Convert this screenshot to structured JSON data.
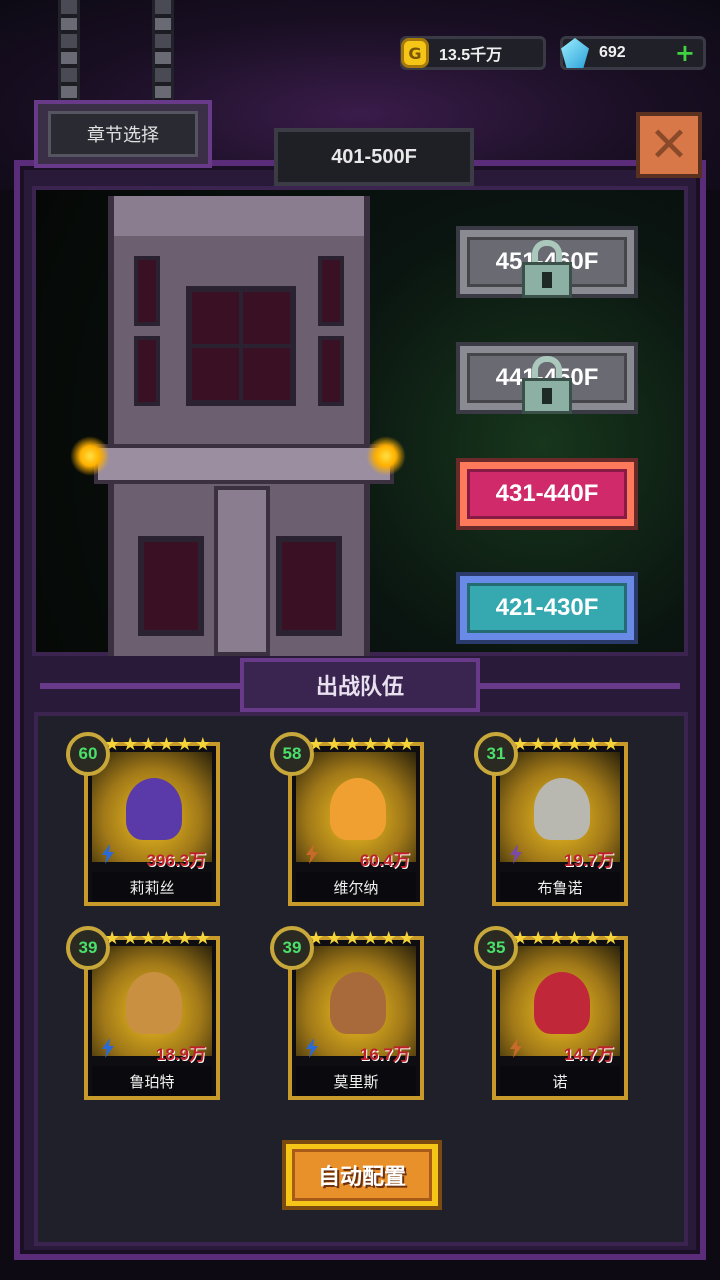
{
  "currency": {
    "coins": "13.5千万",
    "gems": "692",
    "coin_icon_label": "G"
  },
  "header": {
    "chapter_button": "章节选择",
    "floor_range_title": "401-500F",
    "close_label": "✕"
  },
  "floors": [
    {
      "label": "451-460F",
      "state": "locked"
    },
    {
      "label": "441-450F",
      "state": "locked"
    },
    {
      "label": "431-440F",
      "state": "current"
    },
    {
      "label": "421-430F",
      "state": "cleared"
    }
  ],
  "team": {
    "title": "出战队伍",
    "heroes": [
      {
        "name": "莉莉丝",
        "level": "60",
        "power": "396.3万",
        "color": "#5a3aa8",
        "element": "lightning"
      },
      {
        "name": "维尔纳",
        "level": "58",
        "power": "60.4万",
        "color": "#f0a030",
        "element": "flame"
      },
      {
        "name": "布鲁诺",
        "level": "31",
        "power": "19.7万",
        "color": "#b8b8b0",
        "element": "dark"
      },
      {
        "name": "鲁珀特",
        "level": "39",
        "power": "18.9万",
        "color": "#c89040",
        "element": "lightning"
      },
      {
        "name": "莫里斯",
        "level": "39",
        "power": "16.7万",
        "color": "#a86a3a",
        "element": "lightning"
      },
      {
        "name": "诺",
        "level": "35",
        "power": "14.7万",
        "color": "#c0283a",
        "element": "flame"
      }
    ]
  },
  "auto_button": "自动配置",
  "colors": {
    "frame": "#5a2c7a",
    "gold": "#f5c518",
    "level_text": "#4ae06a",
    "power_text": "#c0202a"
  }
}
